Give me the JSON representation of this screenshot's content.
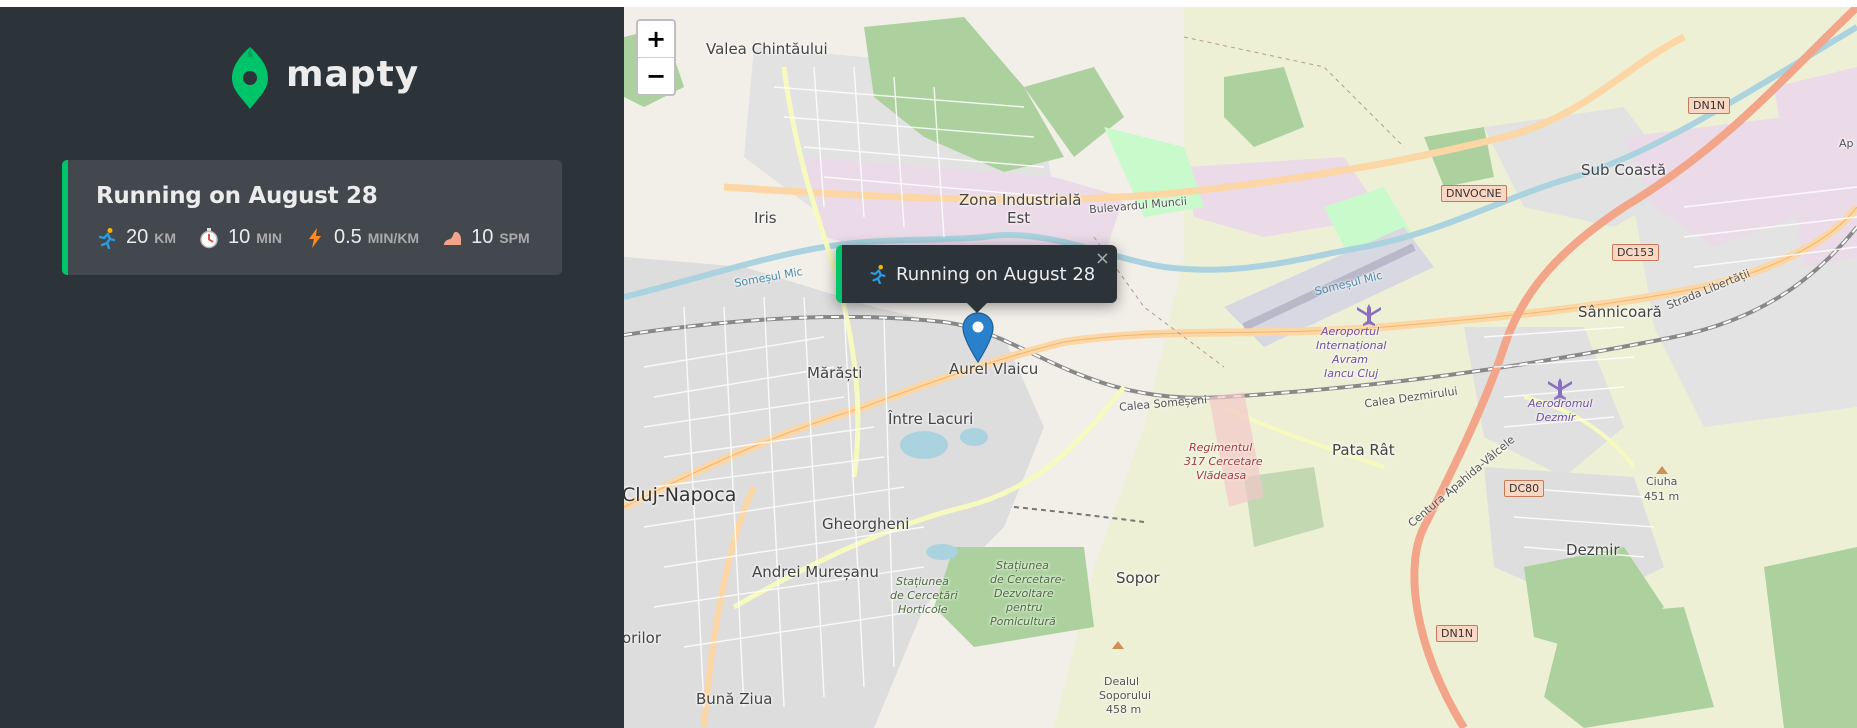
{
  "app": {
    "name": "mapty"
  },
  "workouts": [
    {
      "title": "Running on August 28",
      "distance": {
        "value": "20",
        "unit": "km",
        "icon": "runner-icon"
      },
      "duration": {
        "value": "10",
        "unit": "min",
        "icon": "stopwatch-icon"
      },
      "pace": {
        "value": "0.5",
        "unit": "min/km",
        "icon": "lightning-icon"
      },
      "cadence": {
        "value": "10",
        "unit": "spm",
        "icon": "footprint-icon"
      }
    }
  ],
  "map": {
    "zoom_in": "+",
    "zoom_out": "−",
    "popup": {
      "text": "Running on August 28",
      "close": "×"
    },
    "labels": {
      "valea_chintaului": "Valea Chintăului",
      "iris": "Iris",
      "zona_industriala": "Zona Industrială",
      "est": "Est",
      "marasti": "Mărăști",
      "aurel_vlaicu": "Aurel Vlaicu",
      "intre_lacuri": "Între Lacuri",
      "cluj_napoca": "Cluj-Napoca",
      "gheorgheni": "Gheorgheni",
      "andrei_muresanu": "Andrei Mureșanu",
      "sopor": "Sopor",
      "buna_ziua": "Bună Ziua",
      "orilor": "orilor",
      "pata_rat": "Pata Rât",
      "sub_coasta": "Sub Coastă",
      "sannicoara": "Sânnicoară",
      "dezmir": "Dezmir",
      "ciuha": "Ciuha",
      "ciuha_alt": "451 m",
      "dealul": "Dealul",
      "soporului": "Soporului",
      "dealul_alt": "458 m",
      "aeroport_1": "Aeroportul",
      "aeroport_2": "Internațional",
      "aeroport_3": "Avram",
      "aeroport_4": "Iancu Cluj",
      "aerodrom_1": "Aerodromul",
      "aerodrom_2": "Dezmir",
      "regiment_1": "Regimentul",
      "regiment_2": "317 Cercetare",
      "regiment_3": "Vlădeasa",
      "statiunea_a1": "Stațiunea",
      "statiunea_a2": "de Cercetări",
      "statiunea_a3": "Horticole",
      "statiunea_b1": "Stațiunea",
      "statiunea_b2": "de Cercetare-",
      "statiunea_b3": "Dezvoltare",
      "statiunea_b4": "pentru",
      "statiunea_b5": "Pomicultură",
      "somesul_mic": "Someșul Mic",
      "calea_someseni": "Calea Someșeni",
      "calea_dezmirului": "Calea Dezmirului",
      "bulevardul_muncii": "Bulevardul Muncii",
      "centura": "Centura Apahida-Vâlcele",
      "strada_libertatii": "Strada Libertății",
      "eni": "eni",
      "ap": "Ap"
    },
    "shields": {
      "dn1n_top": "DN1N",
      "dnvocne": "DNVOCNE",
      "dc153": "DC153",
      "dc80": "DC80",
      "dn1n_bottom": "DN1N"
    }
  },
  "colors": {
    "sidebar_bg": "#2d3439",
    "card_bg": "#42484d",
    "brand_green": "#00c46a",
    "text_light": "#ececec",
    "marker_blue": "#2a81cb"
  }
}
